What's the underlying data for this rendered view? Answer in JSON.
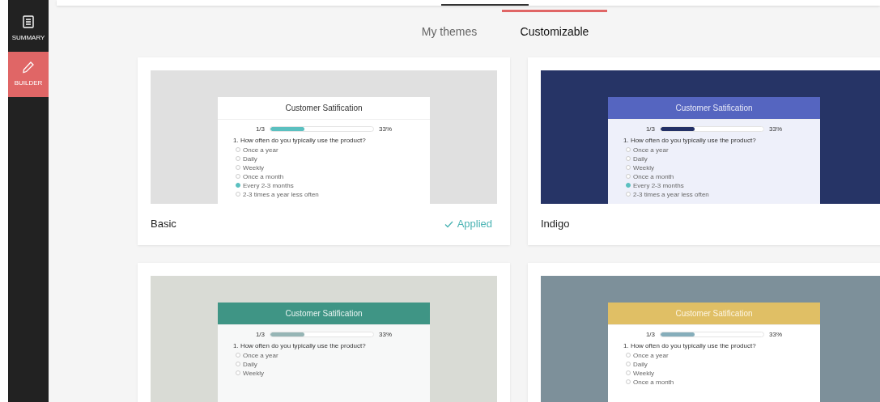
{
  "sidebar": {
    "items": [
      {
        "label": "SUMMARY",
        "selected": false
      },
      {
        "label": "BUILDER",
        "selected": true
      }
    ]
  },
  "tabs": [
    {
      "label": "My themes",
      "selected": false
    },
    {
      "label": "Customizable",
      "selected": true
    }
  ],
  "themes": [
    {
      "name": "Basic",
      "kind": "basic",
      "applied": true,
      "applied_label": "Applied",
      "color": "#e0e0e0",
      "preview": {
        "title": "Customer Satification",
        "step": "1/3",
        "progress": {
          "level": 0.33
        },
        "percent": "33%",
        "question": "1. How often do you typically use the product?",
        "options": [
          {
            "label": "Once a year",
            "checked": false
          },
          {
            "label": "Daily",
            "checked": false
          },
          {
            "label": "Weekly",
            "checked": false
          },
          {
            "label": "Once a month",
            "checked": false
          },
          {
            "label": "Every 2-3 months",
            "checked": true
          },
          {
            "label": "2-3 times a year less often",
            "checked": false
          }
        ]
      }
    },
    {
      "name": "Indigo",
      "kind": "indigo",
      "applied": false,
      "color": "#263466",
      "preview": {
        "title": "Customer Satification",
        "step": "1/3",
        "progress": {
          "level": 0.33
        },
        "percent": "33%",
        "question": "1. How often do you typically use the product?",
        "options": [
          {
            "label": "Once a year",
            "checked": false
          },
          {
            "label": "Daily",
            "checked": false
          },
          {
            "label": "Weekly",
            "checked": false
          },
          {
            "label": "Once a month",
            "checked": false
          },
          {
            "label": "Every 2-3 months",
            "checked": true
          },
          {
            "label": "2-3 times a year less often",
            "checked": false
          }
        ]
      }
    },
    {
      "kind": "green",
      "applied": false,
      "color": "#d9dbd5",
      "preview": {
        "title": "Customer Satification",
        "step": "1/3",
        "progress": {
          "level": 0.33
        },
        "percent": "33%",
        "question": "1. How often do you typically use the product?",
        "options": [
          {
            "label": "Once a year",
            "checked": false
          },
          {
            "label": "Daily",
            "checked": false
          },
          {
            "label": "Weekly",
            "checked": false
          }
        ]
      }
    },
    {
      "kind": "gold",
      "applied": false,
      "color": "#7d909a",
      "preview": {
        "title": "Customer Satification",
        "step": "1/3",
        "progress": {
          "level": 0.33
        },
        "percent": "33%",
        "question": "1. How often do you typically use the product?",
        "options": [
          {
            "label": "Once a year",
            "checked": false
          },
          {
            "label": "Daily",
            "checked": false
          },
          {
            "label": "Weekly",
            "checked": false
          },
          {
            "label": "Once a month",
            "checked": false
          }
        ]
      }
    }
  ]
}
